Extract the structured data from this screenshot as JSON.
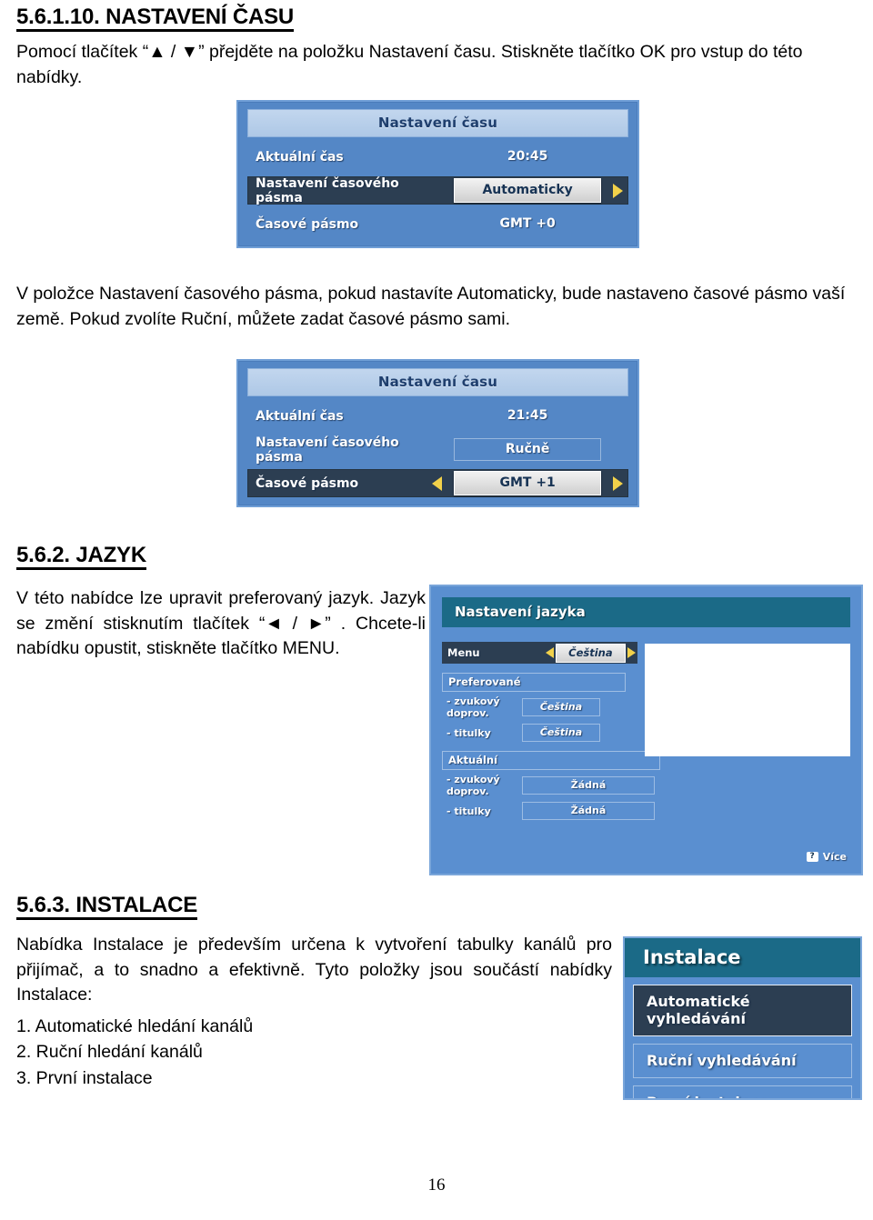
{
  "document": {
    "page_number": "16"
  },
  "sections": {
    "time": {
      "heading": "5.6.1.10. NASTAVENÍ ČASU",
      "intro": "Pomocí tlačítek “▲ / ▼” přejděte na položku Nastavení času. Stiskněte tlačítko OK pro vstup do této nabídky.",
      "note": "V položce Nastavení časového pásma, pokud nastavíte Automaticky, bude nastaveno časové pásmo vaší země. Pokud zvolíte Ruční, můžete zadat časové pásmo sami."
    },
    "language": {
      "heading": "5.6.2. JAZYK",
      "body": "V této nabídce lze upravit preferovaný jazyk. Jazyk se změní stisknutím tlačítek “◄ / ►” . Chcete-li nabídku opustit, stiskněte tlačítko MENU."
    },
    "install": {
      "heading": "5.6.3. INSTALACE",
      "body": "Nabídka Instalace je především určena k vytvoření tabulky kanálů pro přijímač, a to snadno a efektivně. Tyto položky jsou součástí nabídky Instalace:",
      "items": [
        "1. Automatické hledání kanálů",
        "2. Ruční hledání kanálů",
        "3. První instalace"
      ]
    }
  },
  "screenshots": {
    "time_auto": {
      "title": "Nastavení času",
      "rows": [
        {
          "label": "Aktuální čas",
          "value": "20:45",
          "style": "plain",
          "highlight": false,
          "arrow_left": false,
          "arrow_right": false
        },
        {
          "label": "Nastavení časového pásma",
          "value": "Automaticky",
          "style": "box",
          "highlight": true,
          "arrow_left": false,
          "arrow_right": true
        },
        {
          "label": "Časové pásmo",
          "value": "GMT +0",
          "style": "plain",
          "highlight": false,
          "arrow_left": false,
          "arrow_right": false
        }
      ]
    },
    "time_manual": {
      "title": "Nastavení času",
      "rows": [
        {
          "label": "Aktuální čas",
          "value": "21:45",
          "style": "plain",
          "highlight": false,
          "arrow_left": false,
          "arrow_right": false
        },
        {
          "label": "Nastavení časového pásma",
          "value": "Ručně",
          "style": "framed",
          "highlight": false,
          "arrow_left": false,
          "arrow_right": false
        },
        {
          "label": "Časové pásmo",
          "value": "GMT +1",
          "style": "box",
          "highlight": true,
          "arrow_left": true,
          "arrow_right": true
        }
      ]
    },
    "language_menu": {
      "title": "Nastavení jazyka",
      "menu_row": {
        "label": "Menu",
        "value": "Čeština"
      },
      "preferred_heading": "Preferované",
      "preferred": [
        {
          "label": "- zvukový doprov.",
          "value": "Čeština"
        },
        {
          "label": "- titulky",
          "value": "Čeština"
        }
      ],
      "current_heading": "Aktuální",
      "current": [
        {
          "label": "- zvukový doprov.",
          "value": "Žádná"
        },
        {
          "label": "- titulky",
          "value": "Žádná"
        }
      ],
      "footer": {
        "badge": "?",
        "label": "Více"
      }
    },
    "install_menu": {
      "title": "Instalace",
      "items": [
        {
          "label": "Automatické vyhledávání",
          "selected": true
        },
        {
          "label": "Ruční vyhledávání",
          "selected": false
        },
        {
          "label": "První instalace",
          "selected": false
        }
      ]
    }
  },
  "colors": {
    "osd_blue": "#5487c6",
    "osd_light_blue": "#5a8fd0",
    "title_teal": "#1b6a87",
    "highlight_dark": "#2c3e52",
    "arrow_yellow": "#f2d14a"
  }
}
